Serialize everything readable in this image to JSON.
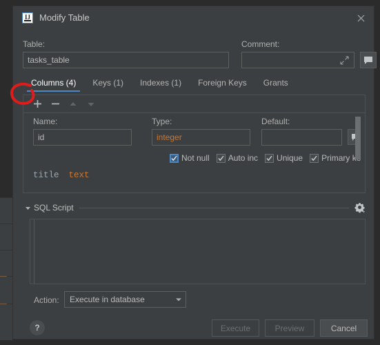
{
  "window": {
    "title": "Modify Table",
    "app_icon": "intellij-idea-icon",
    "close_icon": "close-icon"
  },
  "header": {
    "table_label": "Table:",
    "table_value": "tasks_table",
    "table_placeholder": "",
    "comment_label": "Comment:",
    "comment_value": "",
    "comment_placeholder": "",
    "expand_icon": "expand-diagonal-icon",
    "comment_button_icon": "speech-bubble-icon"
  },
  "tabs": [
    {
      "label": "Columns (4)",
      "active": true
    },
    {
      "label": "Keys (1)",
      "active": false
    },
    {
      "label": "Indexes (1)",
      "active": false
    },
    {
      "label": "Foreign Keys",
      "active": false
    },
    {
      "label": "Grants",
      "active": false
    }
  ],
  "toolbar": {
    "add_label": "+",
    "remove_label": "−",
    "move_up_icon": "triangle-up-icon",
    "move_down_icon": "triangle-down-icon",
    "add_highlighted": true
  },
  "columns_panel": {
    "labels": {
      "name": "Name:",
      "type": "Type:",
      "default": "Default:"
    },
    "expanded_row": {
      "name_value": "id",
      "type_value": "integer",
      "default_value": "",
      "comment_button_icon": "speech-bubble-icon",
      "checkboxes": [
        {
          "label": "Not null",
          "checked": true,
          "focused": true
        },
        {
          "label": "Auto inc",
          "checked": true,
          "focused": false
        },
        {
          "label": "Unique",
          "checked": true,
          "focused": false
        },
        {
          "label": "Primary key",
          "checked": true,
          "focused": false
        }
      ]
    },
    "collapsed_rows": [
      {
        "name": "title",
        "type": "text"
      }
    ]
  },
  "sql_section": {
    "title": "SQL Script",
    "collapse_icon": "chevron-down-icon",
    "settings_icon": "gear-icon",
    "editor_value": ""
  },
  "action_row": {
    "label": "Action:",
    "selected": "Execute in database",
    "dropdown_icon": "chevron-down-icon"
  },
  "footer": {
    "help_label": "?",
    "buttons": [
      {
        "label": "Execute",
        "enabled": false
      },
      {
        "label": "Preview",
        "enabled": false
      },
      {
        "label": "Cancel",
        "enabled": true
      }
    ]
  },
  "annotation": {
    "shape": "red-circle-highlight",
    "color": "#e01b1b",
    "target": "add-column-button"
  },
  "theme": {
    "dialog_bg": "#3c3f41",
    "backdrop_bg": "#2b2b2b",
    "accent": "#4a88c7",
    "type_text": "#cc7832"
  }
}
